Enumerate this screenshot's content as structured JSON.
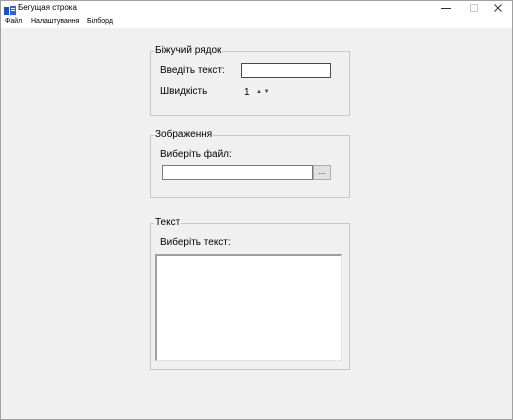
{
  "window": {
    "title": "Бегущая строка",
    "controls": {
      "minimize": "—",
      "maximize": "☐",
      "close": "✕"
    }
  },
  "menu": {
    "items": [
      "Файл",
      "Налаштування",
      "Білборд"
    ]
  },
  "ticker_group": {
    "legend": "Біжучий рядок",
    "text_label": "Введіть текст:",
    "text_value": "",
    "speed_label": "Швидкість",
    "speed_value": "1",
    "speed_arrows": "▲ ▼"
  },
  "image_group": {
    "legend": "Зображення",
    "file_label": "Виберіть файл:",
    "file_value": "",
    "browse_label": "..."
  },
  "text_group": {
    "legend": "Текст",
    "select_label": "Виберіть текст:",
    "text_content": ""
  },
  "colors": {
    "window_bg": "#f0f0f0",
    "titlebar_bg": "#ffffff",
    "group_border": "#c8c8c8",
    "icon_blue": "#1a4fc4"
  },
  "icons": {
    "app": "app-icon",
    "minimize": "minimize-icon",
    "maximize": "maximize-icon",
    "close": "close-icon"
  }
}
